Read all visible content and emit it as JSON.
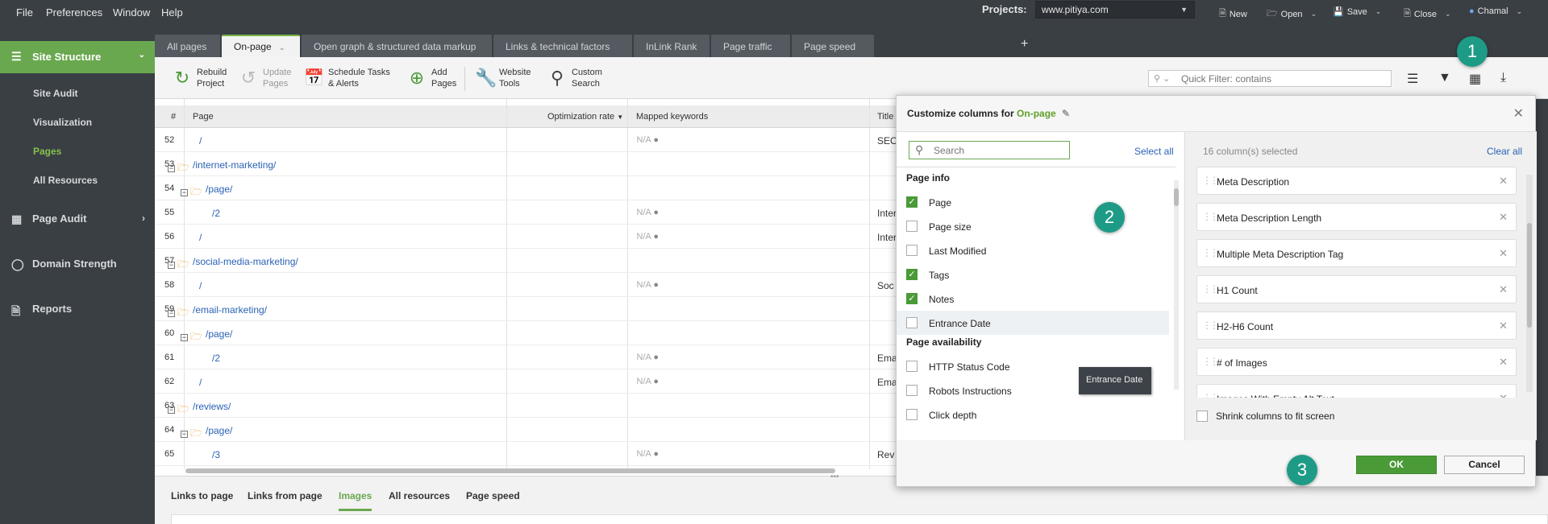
{
  "menu": [
    "File",
    "Preferences",
    "Window",
    "Help"
  ],
  "projects": {
    "label": "Projects:",
    "selected": "www.pitiya.com"
  },
  "top_buttons": {
    "new": "New",
    "open": "Open",
    "save": "Save",
    "close": "Close",
    "user": "Chamal"
  },
  "sidebar": {
    "main": "Site Structure",
    "sub_items": [
      "Site Audit",
      "Visualization",
      "Pages",
      "All Resources"
    ],
    "active_sub": "Pages",
    "sections": [
      "Page Audit",
      "Domain Strength",
      "Reports"
    ]
  },
  "tabs": [
    "All pages",
    "On-page",
    "Open graph & structured data markup",
    "Links & technical factors",
    "InLink Rank",
    "Page traffic",
    "Page speed"
  ],
  "active_tab": "On-page",
  "toolbar": {
    "rebuild": [
      "Rebuild",
      "Project"
    ],
    "update": [
      "Update",
      "Pages"
    ],
    "schedule": [
      "Schedule Tasks",
      "& Alerts"
    ],
    "add": [
      "Add",
      "Pages"
    ],
    "tools": [
      "Website",
      "Tools"
    ],
    "search": [
      "Custom",
      "Search"
    ],
    "filter_placeholder": "Quick Filter: contains"
  },
  "table": {
    "headers": {
      "num": "#",
      "page": "Page",
      "opt": "Optimization rate",
      "kw": "Mapped keywords",
      "title": "Title"
    },
    "rows": [
      {
        "num": "52",
        "page": "/",
        "level": 2,
        "folder": false,
        "opt": "N/A",
        "title": "SEO"
      },
      {
        "num": "53",
        "page": "/internet-marketing/",
        "level": 0,
        "folder": true,
        "opt": "",
        "title": ""
      },
      {
        "num": "54",
        "page": "/page/",
        "level": 1,
        "folder": true,
        "opt": "",
        "title": ""
      },
      {
        "num": "55",
        "page": "/2",
        "level": 3,
        "folder": false,
        "opt": "N/A",
        "title": "Inter"
      },
      {
        "num": "56",
        "page": "/",
        "level": 2,
        "folder": false,
        "opt": "N/A",
        "title": "Inter"
      },
      {
        "num": "57",
        "page": "/social-media-marketing/",
        "level": 0,
        "folder": true,
        "opt": "",
        "title": ""
      },
      {
        "num": "58",
        "page": "/",
        "level": 2,
        "folder": false,
        "opt": "N/A",
        "title": "Soc"
      },
      {
        "num": "59",
        "page": "/email-marketing/",
        "level": 0,
        "folder": true,
        "opt": "",
        "title": ""
      },
      {
        "num": "60",
        "page": "/page/",
        "level": 1,
        "folder": true,
        "opt": "",
        "title": ""
      },
      {
        "num": "61",
        "page": "/2",
        "level": 3,
        "folder": false,
        "opt": "N/A",
        "title": "Ema"
      },
      {
        "num": "62",
        "page": "/",
        "level": 2,
        "folder": false,
        "opt": "N/A",
        "title": "Ema"
      },
      {
        "num": "63",
        "page": "/reviews/",
        "level": 0,
        "folder": true,
        "opt": "",
        "title": ""
      },
      {
        "num": "64",
        "page": "/page/",
        "level": 1,
        "folder": true,
        "opt": "",
        "title": ""
      },
      {
        "num": "65",
        "page": "/3",
        "level": 3,
        "folder": false,
        "opt": "N/A",
        "title": "Rev"
      }
    ]
  },
  "bottom_tabs": [
    "Links to page",
    "Links from page",
    "Images",
    "All resources",
    "Page speed"
  ],
  "active_bottom_tab": "Images",
  "dialog": {
    "title_prefix": "Customize columns for",
    "title_target": "On-page",
    "search_placeholder": "Search",
    "select_all": "Select all",
    "groups": [
      {
        "name": "Page info",
        "items": [
          {
            "label": "Page",
            "checked": true
          },
          {
            "label": "Page size",
            "checked": false
          },
          {
            "label": "Last Modified",
            "checked": false
          },
          {
            "label": "Tags",
            "checked": true
          },
          {
            "label": "Notes",
            "checked": true
          },
          {
            "label": "Entrance Date",
            "checked": false
          }
        ]
      },
      {
        "name": "Page availability",
        "items": [
          {
            "label": "HTTP Status Code",
            "checked": false
          },
          {
            "label": "Robots Instructions",
            "checked": false
          },
          {
            "label": "Click depth",
            "checked": false
          }
        ]
      }
    ],
    "tooltip": "Entrance Date",
    "selected_count": "16 column(s) selected",
    "clear_all": "Clear all",
    "selected": [
      "Meta Description",
      "Meta Description Length",
      "Multiple Meta Description Tag",
      "H1 Count",
      "H2-H6 Count",
      "# of Images",
      "Images With Empty Alt Text"
    ],
    "shrink": "Shrink columns to fit screen",
    "ok": "OK",
    "cancel": "Cancel"
  },
  "markers": [
    "1",
    "2",
    "3"
  ]
}
